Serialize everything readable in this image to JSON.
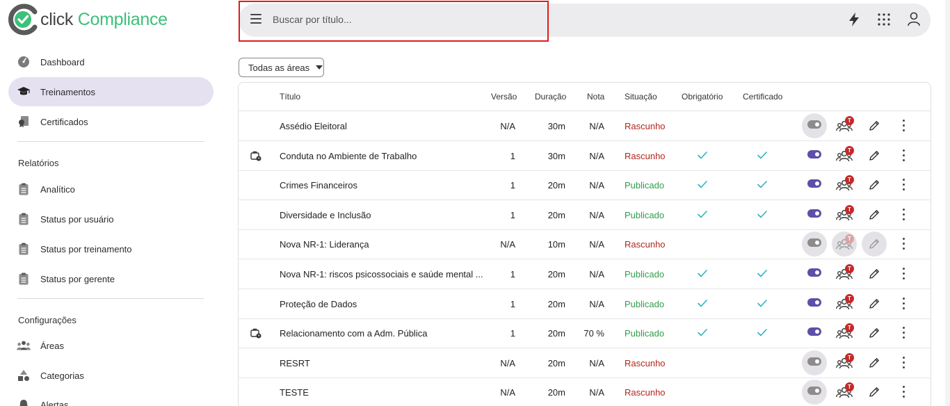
{
  "brand": {
    "part1": "click",
    "part2": "Compliance",
    "accent": "#3cc07a",
    "primary": "#5d4fa8"
  },
  "sidebar": {
    "items": [
      {
        "label": "Dashboard",
        "icon": "gauge-icon"
      },
      {
        "label": "Treinamentos",
        "icon": "graduation-cap-icon",
        "active": true
      },
      {
        "label": "Certificados",
        "icon": "certificate-icon"
      }
    ],
    "reports_title": "Relatórios",
    "reports": [
      {
        "label": "Analítico",
        "icon": "clipboard-icon"
      },
      {
        "label": "Status por usuário",
        "icon": "clipboard-icon"
      },
      {
        "label": "Status por treinamento",
        "icon": "clipboard-icon"
      },
      {
        "label": "Status por gerente",
        "icon": "clipboard-icon"
      }
    ],
    "config_title": "Configurações",
    "config": [
      {
        "label": "Áreas",
        "icon": "group-icon"
      },
      {
        "label": "Categorias",
        "icon": "shapes-icon"
      },
      {
        "label": "Alertas",
        "icon": "bell-icon"
      }
    ]
  },
  "search": {
    "placeholder": "Buscar por título..."
  },
  "filter": {
    "label": "Todas as áreas"
  },
  "table": {
    "headers": [
      "Título",
      "Versão",
      "Duração",
      "Nota",
      "Situação",
      "Obrigatório",
      "Certificado"
    ],
    "rows": [
      {
        "title": "Assédio Eleitoral",
        "version": "N/A",
        "duration": "30m",
        "grade": "N/A",
        "status": "Rascunho",
        "mandatory": false,
        "certificate": false,
        "active": false,
        "bag": false,
        "badge": "T"
      },
      {
        "title": "Conduta no Ambiente de Trabalho",
        "version": "1",
        "duration": "30m",
        "grade": "N/A",
        "status": "Rascunho",
        "mandatory": true,
        "certificate": true,
        "active": true,
        "bag": true,
        "badge": "T"
      },
      {
        "title": "Crimes Financeiros",
        "version": "1",
        "duration": "20m",
        "grade": "N/A",
        "status": "Publicado",
        "mandatory": true,
        "certificate": true,
        "active": true,
        "bag": false,
        "badge": "T"
      },
      {
        "title": "Diversidade e Inclusão",
        "version": "1",
        "duration": "20m",
        "grade": "N/A",
        "status": "Publicado",
        "mandatory": true,
        "certificate": true,
        "active": true,
        "bag": false,
        "badge": "T"
      },
      {
        "title": "Nova NR-1: Liderança",
        "version": "N/A",
        "duration": "10m",
        "grade": "N/A",
        "status": "Rascunho",
        "mandatory": false,
        "certificate": false,
        "active": false,
        "bag": false,
        "badge": "T",
        "disabled": true
      },
      {
        "title": "Nova NR-1: riscos psicossociais e saúde mental ...",
        "version": "1",
        "duration": "20m",
        "grade": "N/A",
        "status": "Publicado",
        "mandatory": true,
        "certificate": true,
        "active": true,
        "bag": false,
        "badge": "T"
      },
      {
        "title": "Proteção de Dados",
        "version": "1",
        "duration": "20m",
        "grade": "N/A",
        "status": "Publicado",
        "mandatory": true,
        "certificate": true,
        "active": true,
        "bag": false,
        "badge": "T"
      },
      {
        "title": "Relacionamento com a Adm. Pública",
        "version": "1",
        "duration": "20m",
        "grade": "70 %",
        "status": "Publicado",
        "mandatory": true,
        "certificate": true,
        "active": true,
        "bag": true,
        "badge": "T"
      },
      {
        "title": "RESRT",
        "version": "N/A",
        "duration": "20m",
        "grade": "N/A",
        "status": "Rascunho",
        "mandatory": false,
        "certificate": false,
        "active": false,
        "bag": false,
        "badge": "T"
      },
      {
        "title": "TESTE",
        "version": "N/A",
        "duration": "20m",
        "grade": "N/A",
        "status": "Rascunho",
        "mandatory": false,
        "certificate": false,
        "active": false,
        "bag": false,
        "badge": "T"
      }
    ]
  },
  "colors": {
    "draft": "#b3261e",
    "published": "#2e9d4a",
    "check": "#2bb3c0",
    "badge": "#c62828"
  }
}
